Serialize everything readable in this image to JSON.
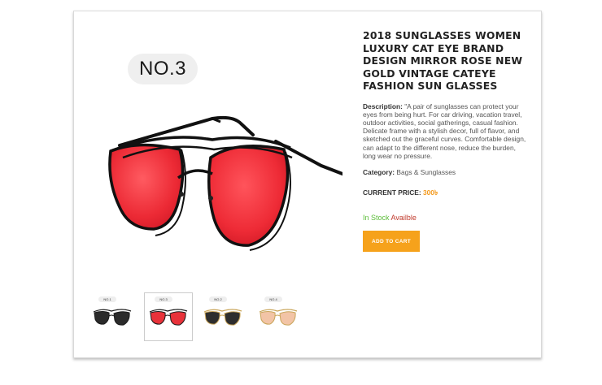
{
  "product": {
    "main_badge": "NO.3",
    "title": "2018 SUNGLASSES WOMEN LUXURY CAT EYE BRAND DESIGN MIRROR ROSE NEW GOLD VINTAGE CATEYE FASHION SUN GLASSES",
    "description_label": "Description:",
    "description_text": " \"A pair of sunglasses can protect your eyes from being hurt. For car driving, vacation travel, outdoor activities, social gatherings, casual fashion. Delicate frame with a stylish decor, full of flavor, and sketched out the graceful curves. Comfortable design, can adapt to the different nose, reduce the burden, long wear no pressure.",
    "category_label": "Category:",
    "category_value": " Bags & Sunglasses",
    "price_label": "CURRENT PRICE:",
    "price_value": " 300৳",
    "stock_in": "In Stock",
    "stock_avail": " Availble",
    "cart_button": "ADD TO CART"
  },
  "thumbnails": [
    {
      "badge": "NO.1",
      "lens_color": "#2b2b2b",
      "frame_color": "#1a1a1a",
      "active": false
    },
    {
      "badge": "NO.3",
      "lens_color": "#e8323a",
      "frame_color": "#1a1a1a",
      "active": true
    },
    {
      "badge": "NO.2",
      "lens_color": "#2e2e2e",
      "frame_color": "#c9a55a",
      "active": false
    },
    {
      "badge": "NO.4",
      "lens_color": "#f2c4a6",
      "frame_color": "#c9a55a",
      "active": false
    }
  ],
  "colors": {
    "accent": "#f6a21b",
    "price": "#f39a1e",
    "in_stock": "#5cbd3a",
    "availability": "#c0392b",
    "main_lens": "#ec2a35"
  }
}
